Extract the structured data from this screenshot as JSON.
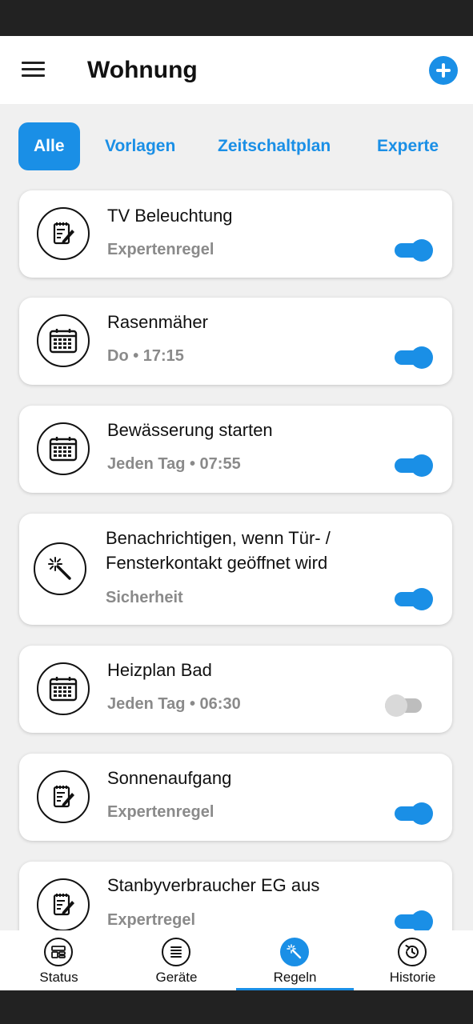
{
  "header": {
    "title": "Wohnung"
  },
  "tabs": [
    {
      "label": "Alle",
      "active": true
    },
    {
      "label": "Vorlagen"
    },
    {
      "label": "Zeitschaltplan"
    },
    {
      "label": "Experte"
    }
  ],
  "rules": [
    {
      "title": "TV Beleuchtung",
      "subtitle": "Expertenregel",
      "icon": "notepad-pencil-icon",
      "enabled": true
    },
    {
      "title": "Rasenmäher",
      "subtitle": "Do • 17:15",
      "icon": "calendar-icon",
      "enabled": true
    },
    {
      "title": "Bewässerung starten",
      "subtitle": "Jeden Tag • 07:55",
      "icon": "calendar-icon",
      "enabled": true
    },
    {
      "title_line1": "Benachrichtigen, wenn Tür- /",
      "title_line2": "Fensterkontakt geöffnet wird",
      "subtitle": "Sicherheit",
      "icon": "magic-wand-icon",
      "enabled": true
    },
    {
      "title": "Heizplan Bad",
      "subtitle": "Jeden Tag • 06:30",
      "icon": "calendar-icon",
      "enabled": false
    },
    {
      "title": "Sonnenaufgang",
      "subtitle": "Expertenregel",
      "icon": "notepad-pencil-icon",
      "enabled": true
    },
    {
      "title": "Stanbyverbraucher EG aus",
      "subtitle": "Expertregel",
      "icon": "notepad-pencil-icon",
      "enabled": true
    }
  ],
  "bottom_nav": [
    {
      "label": "Status",
      "icon": "dashboard-icon"
    },
    {
      "label": "Geräte",
      "icon": "list-icon"
    },
    {
      "label": "Regeln",
      "icon": "magic-wand-icon",
      "active": true
    },
    {
      "label": "Historie",
      "icon": "history-icon"
    }
  ],
  "colors": {
    "accent": "#1a8fe6",
    "text": "#111111",
    "subtext": "#8a8a8a",
    "background": "#f0f0f0"
  }
}
